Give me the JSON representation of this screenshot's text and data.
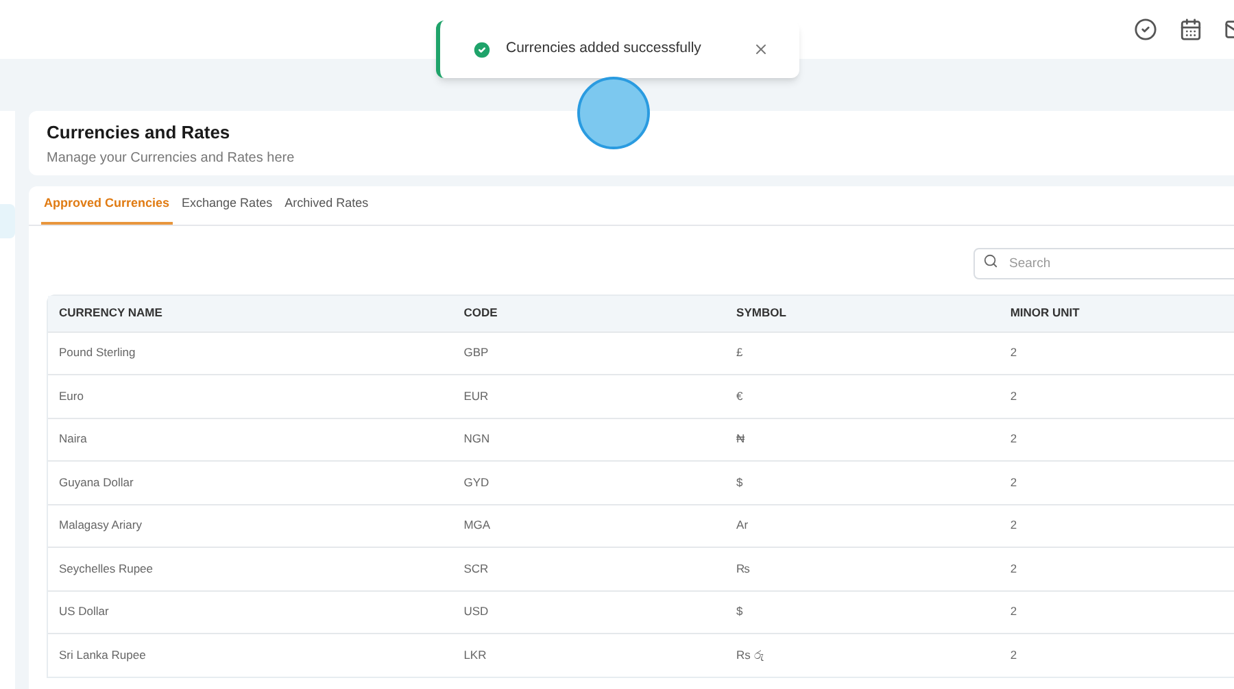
{
  "toast": {
    "message": "Currencies added successfully"
  },
  "page_header": {
    "title": "Currencies and Rates",
    "subtitle": "Manage your Currencies and Rates here"
  },
  "tabs": [
    {
      "label": "Approved Currencies",
      "selected": true
    },
    {
      "label": "Exchange Rates",
      "selected": false
    },
    {
      "label": "Archived Rates",
      "selected": false
    }
  ],
  "search": {
    "placeholder": "Search"
  },
  "table": {
    "columns": [
      "CURRENCY NAME",
      "CODE",
      "SYMBOL",
      "MINOR UNIT"
    ],
    "rows": [
      [
        "Pound Sterling",
        "GBP",
        "£",
        "2"
      ],
      [
        "Euro",
        "EUR",
        "€",
        "2"
      ],
      [
        "Naira",
        "NGN",
        "₦",
        "2"
      ],
      [
        "Guyana Dollar",
        "GYD",
        "$",
        "2"
      ],
      [
        "Malagasy Ariary",
        "MGA",
        "Ar",
        "2"
      ],
      [
        "Seychelles Rupee",
        "SCR",
        "₨",
        "2"
      ],
      [
        "US Dollar",
        "USD",
        "$",
        "2"
      ],
      [
        "Sri Lanka Rupee",
        "LKR",
        "Rs රු",
        "2"
      ]
    ]
  }
}
